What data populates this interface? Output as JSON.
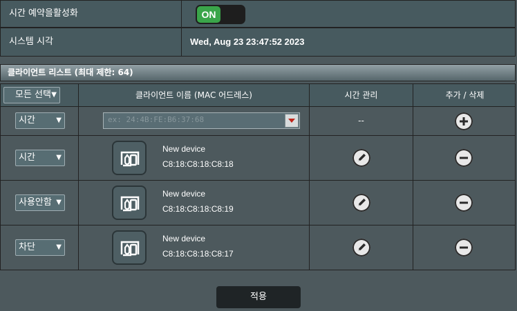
{
  "schedule": {
    "label": "시간 예약을활성화",
    "toggle_state": "ON"
  },
  "system_time": {
    "label": "시스템 시각",
    "value": "Wed, Aug 23 23:47:52 2023"
  },
  "client_list": {
    "title": "클라이언트 리스트 (최대 제한: 64)"
  },
  "table": {
    "headers": {
      "select_all": "모든 선택",
      "client_name": "클라이언트 이름 (MAC 어드레스)",
      "time_management": "시간 관리",
      "add_delete": "추가 / 삭제"
    },
    "new_entry": {
      "mode": "시간",
      "mac_placeholder": "ex: 24:4B:FE:B6:37:68",
      "time_management": "--"
    },
    "devices": [
      {
        "mode": "시간",
        "name": "New device",
        "mac": "C8:18:C8:18:C8:18"
      },
      {
        "mode": "사용안함",
        "name": "New device",
        "mac": "C8:18:C8:18:C8:19"
      },
      {
        "mode": "차단",
        "name": "New device",
        "mac": "C8:18:C8:18:C8:17"
      }
    ]
  },
  "icons": {
    "add": "plus-circle-icon",
    "delete": "minus-circle-icon",
    "edit": "pencil-circle-icon",
    "device": "device-icon",
    "dropdown": "chevron-down-icon"
  },
  "apply": {
    "label": "적용"
  },
  "colors": {
    "toggle_on": "#3aa54a",
    "background": "#4d595d",
    "row_header": "#475a5f"
  }
}
